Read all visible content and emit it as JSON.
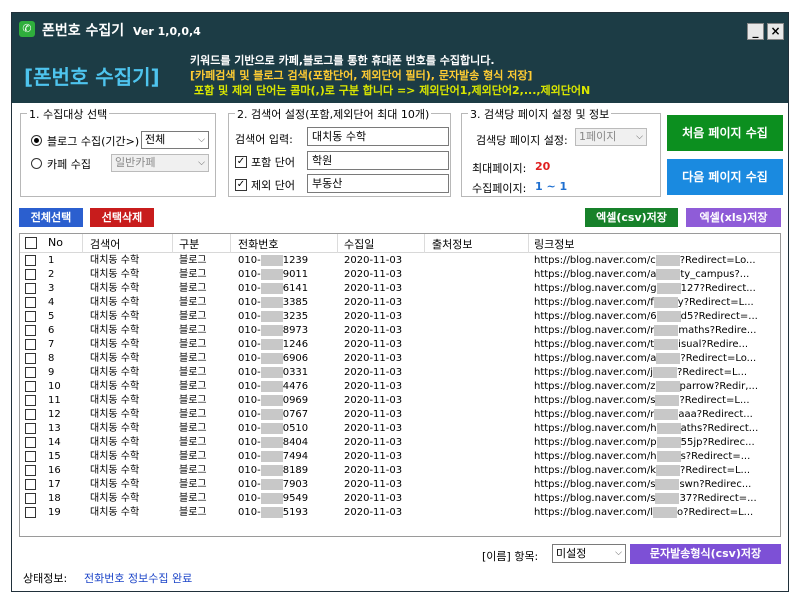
{
  "window": {
    "title": "폰번호 수집기",
    "version": "Ver 1,0,0,4",
    "minimize_label": "_",
    "close_label": "×"
  },
  "banner": {
    "title": "[폰번호 수집기]",
    "line1": "키워드를 기반으로 카페,블로그를 통한 휴대폰 번호를 수집합니다.",
    "line2": "[카페검색 및 블로그 검색(포함단어, 제외단어 필터), 문자발송 형식 저장]",
    "line3": "포함 및 제외 단어는 콤마(,)로 구분 합니다 => 제외단어1,제외단어2,...,제외단어N"
  },
  "collect_target": {
    "legend": "1. 수집대상 선택",
    "blog_label": "블로그 수집(기간>)",
    "blog_selected": true,
    "blog_period": "전체",
    "cafe_label": "카페 수집",
    "cafe_selected": false,
    "cafe_type": "일반카페"
  },
  "search_settings": {
    "legend": "2. 검색어 설정(포함,제외단어 최대 10개)",
    "keyword_label": "검색어 입력:",
    "keyword_value": "대치동 수학",
    "include_label": "포함 단어",
    "include_checked": true,
    "include_value": "학원",
    "exclude_label": "제외 단어",
    "exclude_checked": true,
    "exclude_value": "부동산"
  },
  "page_settings": {
    "legend": "3. 검색당 페이지 설정 및 정보",
    "pages_per_search_label": "검색당 페이지 설정:",
    "pages_per_search_value": "1페이지",
    "max_page_label": "최대페이지:",
    "max_page_value": "20",
    "collect_page_label": "수집페이지:",
    "collect_page_value": "1 ~ 1"
  },
  "actions": {
    "collect_first": "처음 페이지 수집",
    "collect_next": "다음 페이지 수집",
    "select_all": "전체선택",
    "delete_selected": "선택삭제",
    "export_csv": "엑셀(csv)저장",
    "export_xls": "엑셀(xls)저장",
    "export_sms_csv": "문자발송형식(csv)저장"
  },
  "table": {
    "headers": [
      "No",
      "검색어",
      "구분",
      "전화번호",
      "수집일",
      "출처정보",
      "링크정보"
    ],
    "rows": [
      {
        "no": "1",
        "keyword": "대치동 수학",
        "type": "블로그",
        "phone_prefix": "010-",
        "phone_suffix": "1239",
        "date": "2020-11-03",
        "source": "",
        "link_prefix": "https://blog.naver.com/c",
        "link_suffix": "?Redirect=Lo..."
      },
      {
        "no": "2",
        "keyword": "대치동 수학",
        "type": "블로그",
        "phone_prefix": "010-",
        "phone_suffix": "9011",
        "date": "2020-11-03",
        "source": "",
        "link_prefix": "https://blog.naver.com/a",
        "link_suffix": "ty_campus?..."
      },
      {
        "no": "3",
        "keyword": "대치동 수학",
        "type": "블로그",
        "phone_prefix": "010-",
        "phone_suffix": "6141",
        "date": "2020-11-03",
        "source": "",
        "link_prefix": "https://blog.naver.com/g",
        "link_suffix": "127?Redirect..."
      },
      {
        "no": "4",
        "keyword": "대치동 수학",
        "type": "블로그",
        "phone_prefix": "010-",
        "phone_suffix": "3385",
        "date": "2020-11-03",
        "source": "",
        "link_prefix": "https://blog.naver.com/f",
        "link_suffix": "y?Redirect=L..."
      },
      {
        "no": "5",
        "keyword": "대치동 수학",
        "type": "블로그",
        "phone_prefix": "010-",
        "phone_suffix": "3235",
        "date": "2020-11-03",
        "source": "",
        "link_prefix": "https://blog.naver.com/6",
        "link_suffix": "d5?Redirect=..."
      },
      {
        "no": "6",
        "keyword": "대치동 수학",
        "type": "블로그",
        "phone_prefix": "010-",
        "phone_suffix": "8973",
        "date": "2020-11-03",
        "source": "",
        "link_prefix": "https://blog.naver.com/r",
        "link_suffix": "maths?Redire..."
      },
      {
        "no": "7",
        "keyword": "대치동 수학",
        "type": "블로그",
        "phone_prefix": "010-",
        "phone_suffix": "1246",
        "date": "2020-11-03",
        "source": "",
        "link_prefix": "https://blog.naver.com/t",
        "link_suffix": "isual?Redire..."
      },
      {
        "no": "8",
        "keyword": "대치동 수학",
        "type": "블로그",
        "phone_prefix": "010-",
        "phone_suffix": "6906",
        "date": "2020-11-03",
        "source": "",
        "link_prefix": "https://blog.naver.com/a",
        "link_suffix": "?Redirect=Lo..."
      },
      {
        "no": "9",
        "keyword": "대치동 수학",
        "type": "블로그",
        "phone_prefix": "010-",
        "phone_suffix": "0331",
        "date": "2020-11-03",
        "source": "",
        "link_prefix": "https://blog.naver.com/j",
        "link_suffix": "?Redirect=L..."
      },
      {
        "no": "10",
        "keyword": "대치동 수학",
        "type": "블로그",
        "phone_prefix": "010-",
        "phone_suffix": "4476",
        "date": "2020-11-03",
        "source": "",
        "link_prefix": "https://blog.naver.com/z",
        "link_suffix": "parrow?Redir,..."
      },
      {
        "no": "11",
        "keyword": "대치동 수학",
        "type": "블로그",
        "phone_prefix": "010-",
        "phone_suffix": "0969",
        "date": "2020-11-03",
        "source": "",
        "link_prefix": "https://blog.naver.com/s",
        "link_suffix": "?Redirect=L..."
      },
      {
        "no": "12",
        "keyword": "대치동 수학",
        "type": "블로그",
        "phone_prefix": "010-",
        "phone_suffix": "0767",
        "date": "2020-11-03",
        "source": "",
        "link_prefix": "https://blog.naver.com/r",
        "link_suffix": "aaa?Redirect..."
      },
      {
        "no": "13",
        "keyword": "대치동 수학",
        "type": "블로그",
        "phone_prefix": "010-",
        "phone_suffix": "0510",
        "date": "2020-11-03",
        "source": "",
        "link_prefix": "https://blog.naver.com/h",
        "link_suffix": "aths?Redirect..."
      },
      {
        "no": "14",
        "keyword": "대치동 수학",
        "type": "블로그",
        "phone_prefix": "010-",
        "phone_suffix": "8404",
        "date": "2020-11-03",
        "source": "",
        "link_prefix": "https://blog.naver.com/p",
        "link_suffix": "55jp?Redirec..."
      },
      {
        "no": "15",
        "keyword": "대치동 수학",
        "type": "블로그",
        "phone_prefix": "010-",
        "phone_suffix": "7494",
        "date": "2020-11-03",
        "source": "",
        "link_prefix": "https://blog.naver.com/h",
        "link_suffix": "s?Redirect=..."
      },
      {
        "no": "16",
        "keyword": "대치동 수학",
        "type": "블로그",
        "phone_prefix": "010-",
        "phone_suffix": "8189",
        "date": "2020-11-03",
        "source": "",
        "link_prefix": "https://blog.naver.com/k",
        "link_suffix": "?Redirect=L..."
      },
      {
        "no": "17",
        "keyword": "대치동 수학",
        "type": "블로그",
        "phone_prefix": "010-",
        "phone_suffix": "7903",
        "date": "2020-11-03",
        "source": "",
        "link_prefix": "https://blog.naver.com/s",
        "link_suffix": "swn?Redirec..."
      },
      {
        "no": "18",
        "keyword": "대치동 수학",
        "type": "블로그",
        "phone_prefix": "010-",
        "phone_suffix": "9549",
        "date": "2020-11-03",
        "source": "",
        "link_prefix": "https://blog.naver.com/s",
        "link_suffix": "37?Redirect=..."
      },
      {
        "no": "19",
        "keyword": "대치동 수학",
        "type": "블로그",
        "phone_prefix": "010-",
        "phone_suffix": "5193",
        "date": "2020-11-03",
        "source": "",
        "link_prefix": "https://blog.naver.com/l",
        "link_suffix": "o?Redirect=L..."
      }
    ]
  },
  "footer": {
    "name_field_label": "[이름] 항목:",
    "name_field_value": "미설정",
    "status_label": "상태정보:",
    "status_value": "전화번호 정보수집 완료"
  },
  "colors": {
    "header_bg": "#1c3c45",
    "banner_title": "#4ec4ee",
    "btn_green": "#0c8f1f",
    "btn_blue": "#1a8ae0",
    "btn_red": "#c81c1c",
    "btn_purple": "#8f5cd8",
    "status_text": "#1e46c8"
  }
}
